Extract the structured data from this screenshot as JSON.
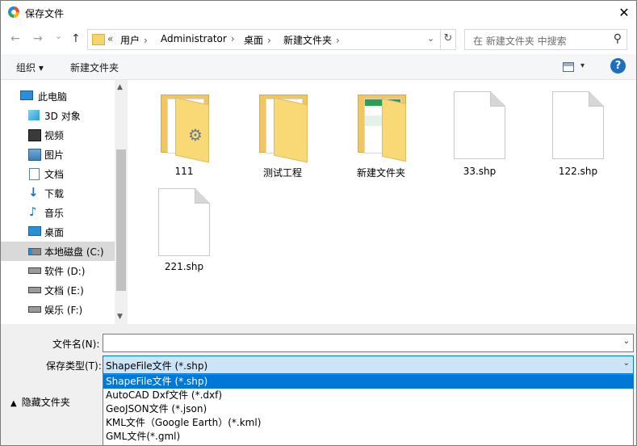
{
  "window": {
    "title": "保存文件",
    "close": "✕"
  },
  "nav": {
    "back": "←",
    "forward": "→",
    "recent": "⌄",
    "up": "↑"
  },
  "address": {
    "overflow": "«",
    "crumbs": [
      "用户",
      "Administrator",
      "桌面",
      "新建文件夹"
    ],
    "separator": "›",
    "dropdown": "⌄",
    "refresh": "↻"
  },
  "search": {
    "placeholder": "在 新建文件夹 中搜索",
    "icon": "⚲"
  },
  "toolbar": {
    "organize": "组织 ▾",
    "new_folder": "新建文件夹",
    "view_arrow": "▾",
    "help": "?"
  },
  "sidebar": {
    "items": [
      {
        "label": "此电脑",
        "icon": "computer-icon"
      },
      {
        "label": "3D 对象",
        "icon": "cube-icon"
      },
      {
        "label": "视频",
        "icon": "video-icon"
      },
      {
        "label": "图片",
        "icon": "picture-icon"
      },
      {
        "label": "文档",
        "icon": "document-icon"
      },
      {
        "label": "下载",
        "icon": "download-icon"
      },
      {
        "label": "音乐",
        "icon": "music-icon"
      },
      {
        "label": "桌面",
        "icon": "desktop-icon"
      },
      {
        "label": "本地磁盘 (C:)",
        "icon": "drive-c-icon"
      },
      {
        "label": "软件 (D:)",
        "icon": "drive-icon"
      },
      {
        "label": "文档 (E:)",
        "icon": "drive-icon"
      },
      {
        "label": "娱乐 (F:)",
        "icon": "drive-icon"
      }
    ],
    "selected_index": 8,
    "scroll_up": "▲",
    "scroll_down": "▼"
  },
  "files": [
    {
      "name": "111",
      "type": "folder"
    },
    {
      "name": "测试工程",
      "type": "folder"
    },
    {
      "name": "新建文件夹",
      "type": "folder"
    },
    {
      "name": "33.shp",
      "type": "file"
    },
    {
      "name": "122.shp",
      "type": "file"
    },
    {
      "name": "221.shp",
      "type": "file"
    }
  ],
  "form": {
    "filename_label": "文件名(N):",
    "filename_value": "",
    "filetype_label": "保存类型(T):",
    "filetype_value": "ShapeFile文件 (*.shp)",
    "chevron": "⌄"
  },
  "dropdown_options": [
    "ShapeFile文件 (*.shp)",
    "AutoCAD Dxf文件 (*.dxf)",
    "GeoJSON文件 (*.json)",
    "KML文件（Google Earth）(*.kml)",
    "GML文件(*.gml)"
  ],
  "footer": {
    "hide_folders": "隐藏文件夹",
    "caret": "▲"
  },
  "colors": {
    "accent": "#0078d7",
    "folder": "#f8d976",
    "help": "#1f6dc2"
  }
}
